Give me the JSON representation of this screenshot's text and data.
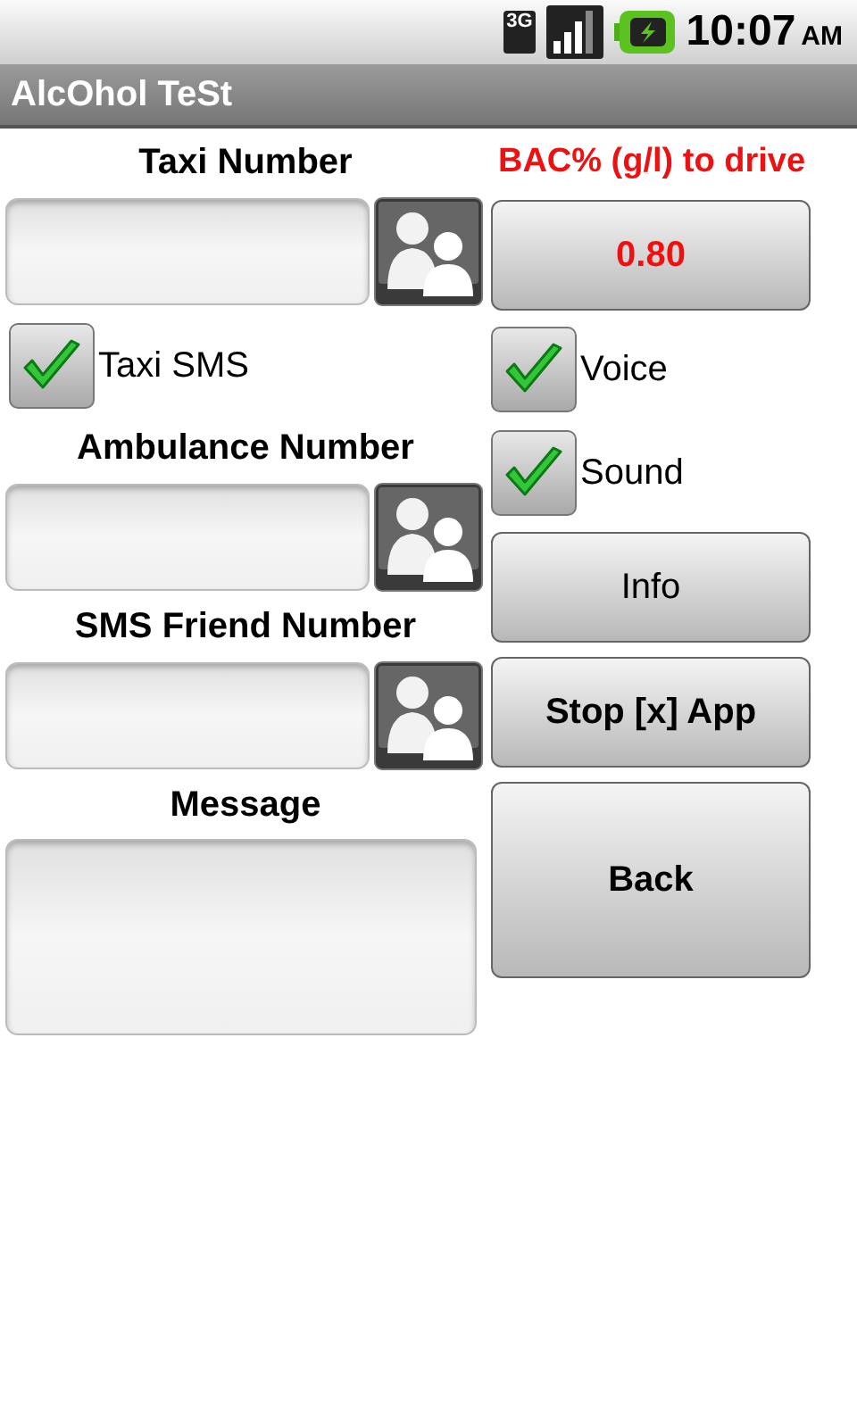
{
  "status_bar": {
    "network": "3G",
    "time": "10:07",
    "period": "AM"
  },
  "title": "AlcOhol TeSt",
  "left": [
    {
      "kind": "label",
      "text": "Taxi Number"
    },
    {
      "kind": "phone_field"
    },
    {
      "kind": "checkbox",
      "label": "Taxi SMS",
      "checked": true
    },
    {
      "kind": "label",
      "text": "Ambulance Number"
    },
    {
      "kind": "phone_field"
    },
    {
      "kind": "label",
      "text": "SMS Friend Number"
    },
    {
      "kind": "phone_field"
    },
    {
      "kind": "label",
      "text": "Message"
    },
    {
      "kind": "message_box"
    }
  ],
  "right": [
    {
      "kind": "heading",
      "text": "BAC% (g/l) to drive"
    },
    {
      "kind": "value_button",
      "label": "0.80"
    },
    {
      "kind": "checkbox",
      "label": "Voice",
      "checked": true
    },
    {
      "kind": "checkbox",
      "label": "Sound",
      "checked": true
    },
    {
      "kind": "button",
      "label": "Info"
    },
    {
      "kind": "bold_button",
      "label": "Stop [x] App"
    },
    {
      "kind": "large_button",
      "label": "Back"
    }
  ]
}
